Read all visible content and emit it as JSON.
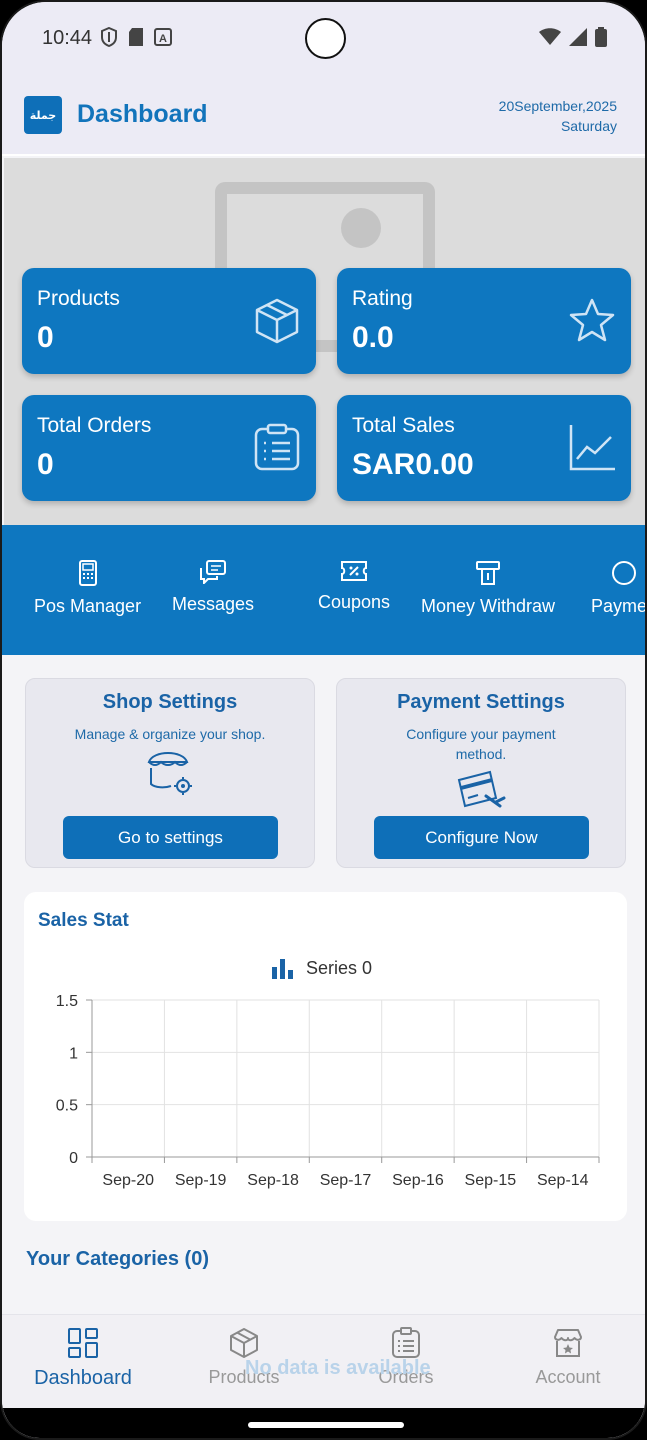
{
  "status_bar": {
    "time": "10:44",
    "left_icons": [
      "shield-icon",
      "sd-card-icon",
      "a-box-icon"
    ],
    "right_icons": [
      "wifi-icon",
      "signal-icon",
      "battery-icon"
    ]
  },
  "header": {
    "logo_text": "جملة",
    "title": "Dashboard",
    "date_line1": "20September,2025",
    "date_line2": "Saturday"
  },
  "stats": [
    {
      "label": "Products",
      "value": "0",
      "icon": "box-icon"
    },
    {
      "label": "Rating",
      "value": "0.0",
      "icon": "star-icon"
    },
    {
      "label": "Total Orders",
      "value": "0",
      "icon": "clipboard-icon"
    },
    {
      "label": "Total Sales",
      "value": "SAR0.00",
      "icon": "trend-chart-icon"
    }
  ],
  "actions": [
    {
      "label": "Pos Manager",
      "icon": "pos-icon"
    },
    {
      "label": "Messages",
      "icon": "messages-icon"
    },
    {
      "label": "Coupons",
      "icon": "coupon-icon"
    },
    {
      "label": "Money Withdraw",
      "icon": "withdraw-icon"
    },
    {
      "label": "Paymen",
      "icon": "payment-icon"
    }
  ],
  "settings_cards": [
    {
      "title": "Shop Settings",
      "description": "Manage & organize your shop.",
      "button": "Go to settings",
      "icon": "shop-settings-icon"
    },
    {
      "title": "Payment Settings",
      "description": "Configure your payment method.",
      "button": "Configure Now",
      "icon": "payment-card-icon"
    }
  ],
  "sales_stat": {
    "title": "Sales Stat"
  },
  "chart_data": {
    "type": "bar",
    "title": "",
    "categories": [
      "Sep-20",
      "Sep-19",
      "Sep-18",
      "Sep-17",
      "Sep-16",
      "Sep-15",
      "Sep-14"
    ],
    "series": [
      {
        "name": "Series 0",
        "values": [
          0,
          0,
          0,
          0,
          0,
          0,
          0
        ]
      }
    ],
    "ylim": [
      0,
      1.5
    ],
    "yticks": [
      "1.5",
      "1",
      "0.5",
      "0"
    ],
    "grid": true,
    "legend": "top-center",
    "color": "#1a63a6"
  },
  "categories": {
    "title": "Your Categories (0)",
    "empty_text": "No data is available"
  },
  "bottom_nav": [
    {
      "label": "Dashboard",
      "icon": "dashboard-icon",
      "active": true
    },
    {
      "label": "Products",
      "icon": "box-icon",
      "active": false
    },
    {
      "label": "Orders",
      "icon": "clipboard-icon",
      "active": false
    },
    {
      "label": "Account",
      "icon": "store-icon",
      "active": false
    }
  ],
  "colors": {
    "primary": "#0e77c0",
    "title_blue": "#1a63a6"
  }
}
